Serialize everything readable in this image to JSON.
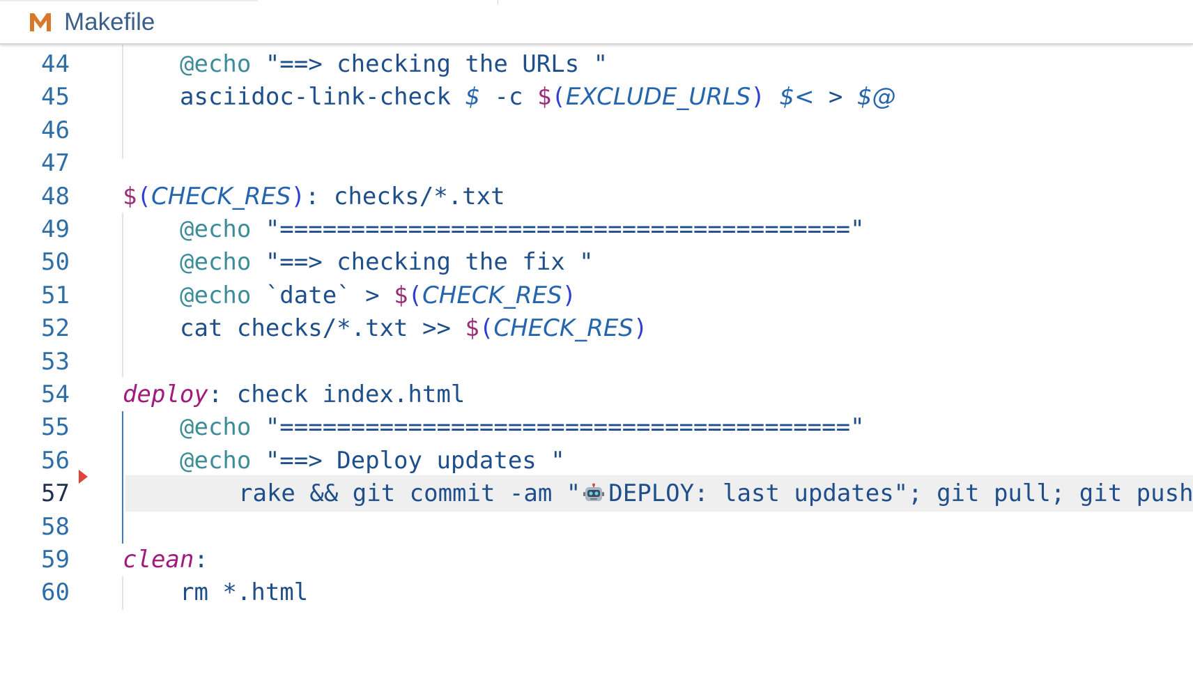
{
  "tab": {
    "icon": "m-file-icon",
    "title": "Makefile",
    "icon_color": "#d9772b"
  },
  "editor": {
    "current_line": "57",
    "lines": [
      {
        "no": "44",
        "tokens": [
          [
            "kw",
            "@echo"
          ],
          [
            "pl",
            " \"==> checking the URLs \""
          ]
        ]
      },
      {
        "no": "45",
        "tokens": [
          [
            "pl",
            "asciidoc-link-check "
          ],
          [
            "var",
            "$"
          ],
          [
            "pl",
            " -c "
          ],
          [
            "dl",
            "$"
          ],
          [
            "par",
            "("
          ],
          [
            "var",
            "EXCLUDE_URLS"
          ],
          [
            "par",
            ")"
          ],
          [
            "pl",
            " "
          ],
          [
            "var",
            "$<"
          ],
          [
            "pl",
            " > "
          ],
          [
            "var",
            "$@"
          ]
        ]
      },
      {
        "no": "46",
        "tokens": []
      },
      {
        "no": "47",
        "tokens": []
      },
      {
        "no": "48",
        "tokens": [
          [
            "dl",
            "$"
          ],
          [
            "par",
            "("
          ],
          [
            "var",
            "CHECK_RES"
          ],
          [
            "par",
            ")"
          ],
          [
            "col",
            ": checks/*.txt"
          ]
        ]
      },
      {
        "no": "49",
        "tokens": [
          [
            "kw",
            "@echo"
          ],
          [
            "pl",
            " \"========================================\""
          ]
        ]
      },
      {
        "no": "50",
        "tokens": [
          [
            "kw",
            "@echo"
          ],
          [
            "pl",
            " \"==> checking the fix \""
          ]
        ]
      },
      {
        "no": "51",
        "tokens": [
          [
            "kw",
            "@echo"
          ],
          [
            "pl",
            " `date` > "
          ],
          [
            "dl",
            "$"
          ],
          [
            "par",
            "("
          ],
          [
            "var",
            "CHECK_RES"
          ],
          [
            "par",
            ")"
          ]
        ]
      },
      {
        "no": "52",
        "tokens": [
          [
            "pl",
            "cat checks/*.txt >> "
          ],
          [
            "dl",
            "$"
          ],
          [
            "par",
            "("
          ],
          [
            "var",
            "CHECK_RES"
          ],
          [
            "par",
            ")"
          ]
        ]
      },
      {
        "no": "53",
        "tokens": []
      },
      {
        "no": "54",
        "tokens": [
          [
            "tgt",
            "deploy"
          ],
          [
            "col",
            ": check index.html"
          ]
        ]
      },
      {
        "no": "55",
        "tokens": [
          [
            "kw",
            "@echo"
          ],
          [
            "pl",
            " \"========================================\""
          ]
        ]
      },
      {
        "no": "56",
        "tokens": [
          [
            "kw",
            "@echo"
          ],
          [
            "pl",
            " \"==> Deploy updates \""
          ]
        ]
      },
      {
        "no": "57",
        "tokens": [
          [
            "pl",
            "rake && git commit -am \""
          ],
          [
            "robot",
            ""
          ],
          [
            "pl",
            "DEPLOY: last updates\"; git pull; git push"
          ]
        ]
      },
      {
        "no": "58",
        "tokens": []
      },
      {
        "no": "59",
        "tokens": [
          [
            "tgt",
            "clean"
          ],
          [
            "col",
            ":"
          ]
        ]
      },
      {
        "no": "60",
        "tokens": [
          [
            "pl",
            "rm *.html"
          ]
        ]
      }
    ],
    "indented_lines": [
      "44",
      "45",
      "49",
      "50",
      "51",
      "52",
      "55",
      "56",
      "57",
      "60"
    ]
  },
  "colors": {
    "line_number": "#2e6ea8",
    "current_line_bg": "#efefef",
    "breakpoint": "#e0443d",
    "active_indent_guide": "#3b7bd3"
  }
}
